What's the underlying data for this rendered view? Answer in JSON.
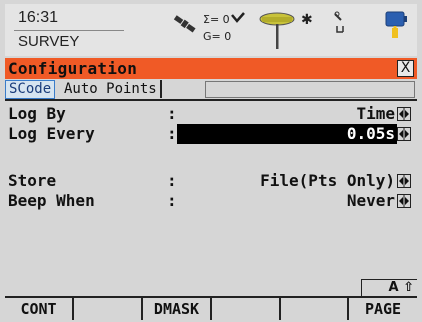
{
  "status": {
    "time": "16:31",
    "app": "SURVEY",
    "sat_sum": "Σ= 0",
    "sat_g": "G= 0",
    "bluetooth_icon": "bluetooth-icon",
    "battery_color": "#f0c020"
  },
  "dialog": {
    "title": "Configuration",
    "close_label": "X"
  },
  "tabs": [
    {
      "label": "SCode"
    },
    {
      "label": "Auto Points"
    }
  ],
  "fields": {
    "log_by": {
      "label": "Log By",
      "colon": ":",
      "value": "Time"
    },
    "log_every": {
      "label": "Log Every",
      "colon": ":",
      "value": "0.05s"
    },
    "store": {
      "label": "Store",
      "colon": ":",
      "value": "File(Pts Only)"
    },
    "beep_when": {
      "label": "Beep When",
      "colon": ":",
      "value": "Never"
    }
  },
  "mode_indicator": "A ⇧",
  "fkeys": [
    "CONT",
    "",
    "DMASK",
    "",
    "",
    "PAGE"
  ],
  "colors": {
    "title_bar": "#f05a26",
    "highlight": "#000000"
  }
}
